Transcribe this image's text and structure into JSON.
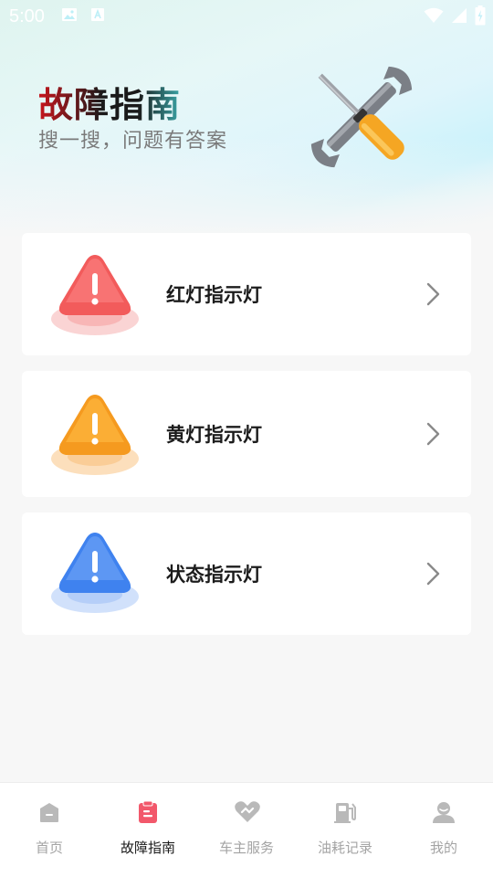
{
  "status_bar": {
    "time": "5:00"
  },
  "header": {
    "title": "故障指南",
    "subtitle": "搜一搜，问题有答案"
  },
  "cards": [
    {
      "label": "红灯指示灯",
      "color": "#f25b5b",
      "icon": "red-warning-icon"
    },
    {
      "label": "黄灯指示灯",
      "color": "#f7a32a",
      "icon": "yellow-warning-icon"
    },
    {
      "label": "状态指示灯",
      "color": "#4d8df2",
      "icon": "blue-warning-icon"
    }
  ],
  "bottom_nav": {
    "items": [
      {
        "label": "首页",
        "icon": "home-icon",
        "active": false
      },
      {
        "label": "故障指南",
        "icon": "clipboard-icon",
        "active": true
      },
      {
        "label": "车主服务",
        "icon": "service-icon",
        "active": false
      },
      {
        "label": "油耗记录",
        "icon": "fuel-pump-icon",
        "active": false
      },
      {
        "label": "我的",
        "icon": "user-icon",
        "active": false
      }
    ],
    "active_color": "#f2586b",
    "inactive_color": "#b9b9b9"
  }
}
